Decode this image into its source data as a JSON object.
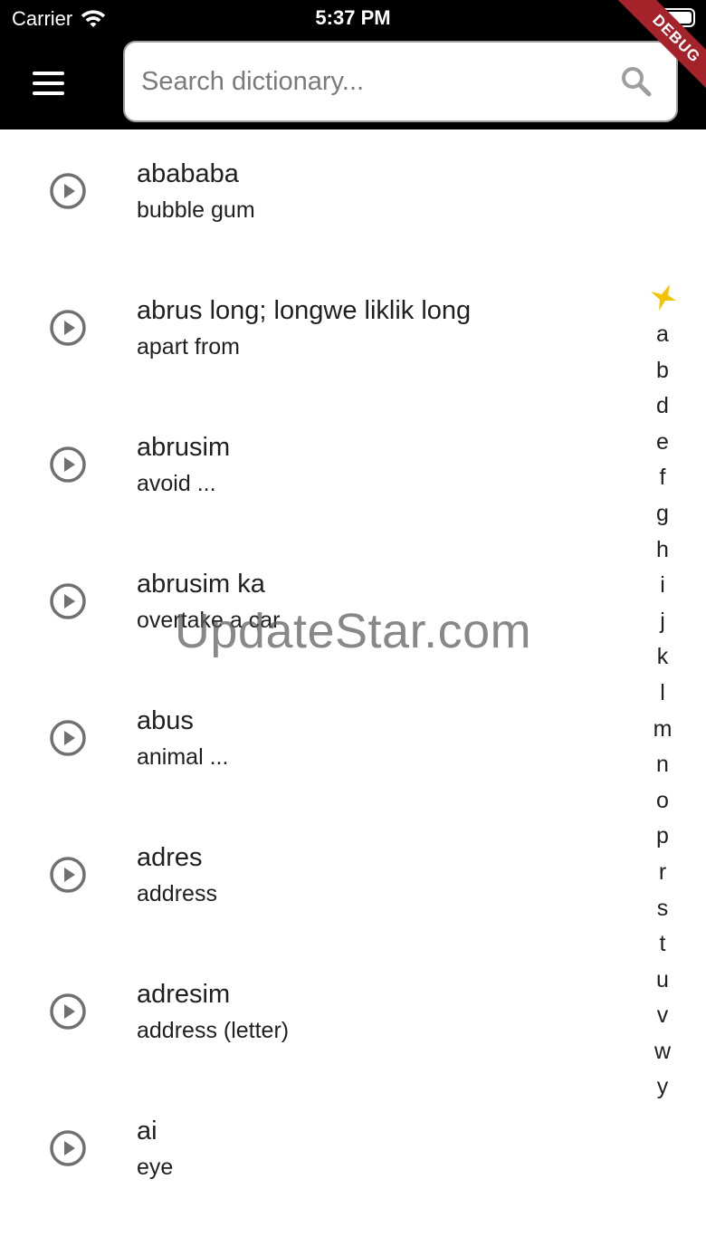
{
  "status_bar": {
    "carrier": "Carrier",
    "time": "5:37 PM"
  },
  "app_bar": {
    "menu_icon": "hamburger-menu-icon",
    "search_placeholder": "Search dictionary...",
    "search_icon": "search-icon",
    "debug_label": "DEBUG"
  },
  "entries": [
    {
      "term": "abababa",
      "gloss": "bubble gum"
    },
    {
      "term": "abrus long; longwe liklik long",
      "gloss": "apart from"
    },
    {
      "term": "abrusim",
      "gloss": "avoid ..."
    },
    {
      "term": "abrusim ka",
      "gloss": "overtake a car"
    },
    {
      "term": "abus",
      "gloss": "animal ..."
    },
    {
      "term": "adres",
      "gloss": "address"
    },
    {
      "term": "adresim",
      "gloss": "address (letter)"
    },
    {
      "term": "ai",
      "gloss": "eye"
    }
  ],
  "alphabet_index": {
    "top_icon": "star-icon",
    "letters": [
      "a",
      "b",
      "d",
      "e",
      "f",
      "g",
      "h",
      "i",
      "j",
      "k",
      "l",
      "m",
      "n",
      "o",
      "p",
      "r",
      "s",
      "t",
      "u",
      "v",
      "w",
      "y"
    ]
  },
  "watermark": "UpdateStar.com",
  "colors": {
    "app_bar": "#000000",
    "icon_gray": "#707070",
    "index_star": "#f5c400",
    "debug_ribbon": "#a4232a"
  }
}
